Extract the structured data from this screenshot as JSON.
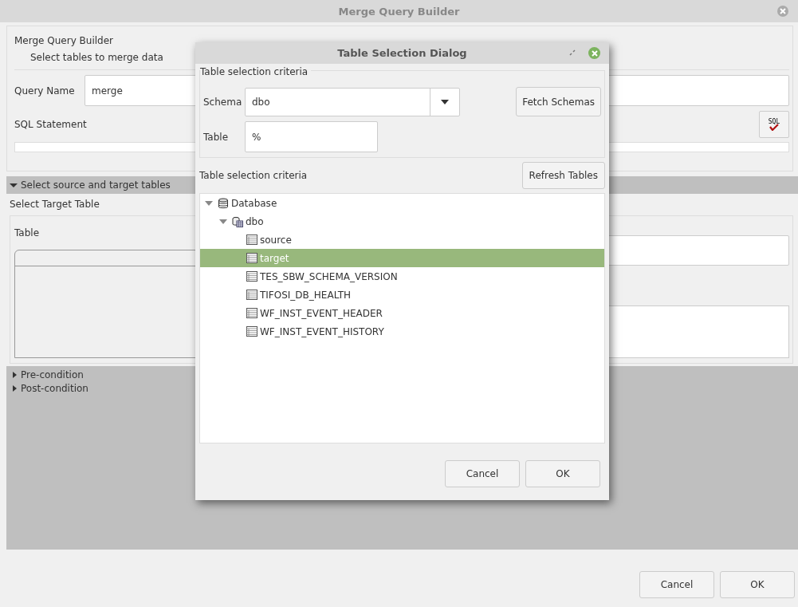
{
  "window": {
    "title": "Merge Query Builder"
  },
  "header": {
    "title": "Merge Query Builder",
    "subtitle": "Select tables to merge data"
  },
  "query_name": {
    "label": "Query Name",
    "value": "merge"
  },
  "sql_statement": {
    "label": "SQL Statement",
    "button_text": "SQL"
  },
  "source_target_section": {
    "label": "Select source and target tables",
    "expanded": true,
    "target_label": "Select Target Table",
    "table_label": "Table"
  },
  "collapsed_sections": [
    {
      "label": "Pre-condition",
      "expanded": false
    },
    {
      "label": "Post-condition",
      "expanded": false
    }
  ],
  "buttons": [
    {
      "label": "Cancel"
    },
    {
      "label": "OK"
    }
  ],
  "dialog": {
    "title": "Table Selection Dialog",
    "criteria_group": {
      "title": "Table selection criteria",
      "schema_label": "Schema",
      "schema_value": "dbo",
      "fetch_button": "Fetch Schemas",
      "table_label": "Table",
      "table_value": "%"
    },
    "tree_label": "Table selection criteria",
    "refresh_button": "Refresh Tables",
    "tree": [
      {
        "label": "Database",
        "kind": "database",
        "expanded": true,
        "selected": false,
        "children": [
          {
            "label": "dbo",
            "kind": "schema",
            "expanded": true,
            "selected": false,
            "children": [
              {
                "label": "source",
                "kind": "table",
                "selected": false
              },
              {
                "label": "target",
                "kind": "table",
                "selected": true
              },
              {
                "label": "TES_SBW_SCHEMA_VERSION",
                "kind": "table",
                "selected": false
              },
              {
                "label": "TIFOSI_DB_HEALTH",
                "kind": "table",
                "selected": false
              },
              {
                "label": "WF_INST_EVENT_HEADER",
                "kind": "table",
                "selected": false
              },
              {
                "label": "WF_INST_EVENT_HISTORY",
                "kind": "table",
                "selected": false
              }
            ]
          }
        ]
      }
    ],
    "buttons": [
      {
        "label": "Cancel"
      },
      {
        "label": "OK"
      }
    ]
  }
}
